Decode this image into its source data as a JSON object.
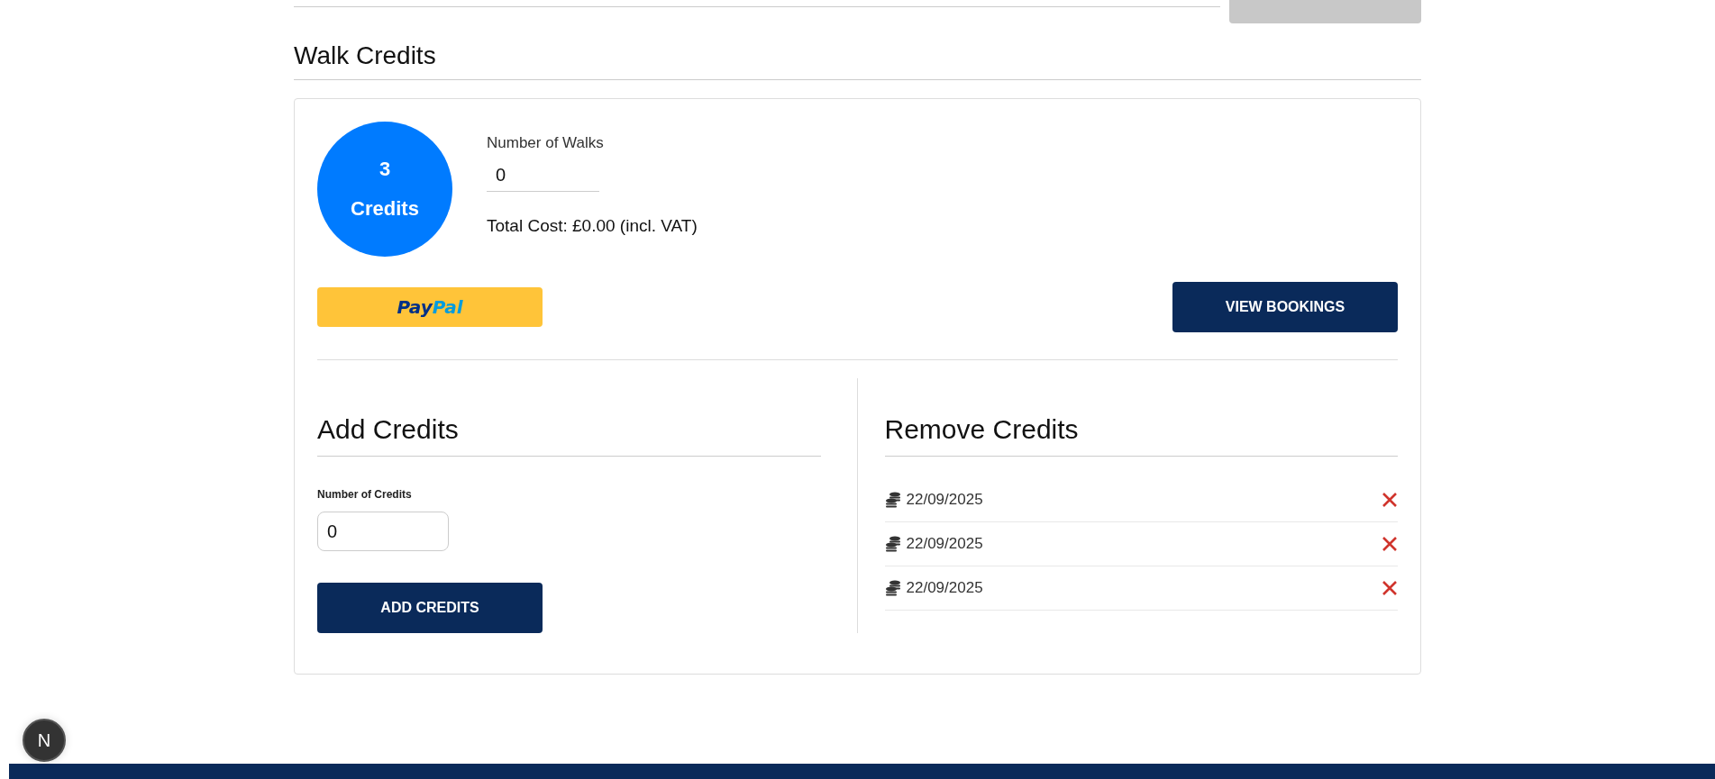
{
  "top_button": {
    "disabled": true
  },
  "section": {
    "title": "Walk Credits"
  },
  "balance": {
    "count": "3",
    "unit": "Credits"
  },
  "walks_field": {
    "label": "Number of Walks",
    "value": "0"
  },
  "total_cost": "Total Cost: £0.00 (incl. VAT)",
  "paypal_button": {
    "label_dark": "Pay",
    "label_light": "Pal"
  },
  "view_bookings_button": "VIEW BOOKINGS",
  "add_credits": {
    "title": "Add Credits",
    "field_label": "Number of Credits",
    "value": "0",
    "button": "ADD CREDITS"
  },
  "remove_credits": {
    "title": "Remove Credits",
    "items": [
      {
        "date": "22/09/2025"
      },
      {
        "date": "22/09/2025"
      },
      {
        "date": "22/09/2025"
      }
    ]
  },
  "dev_badge": "N"
}
